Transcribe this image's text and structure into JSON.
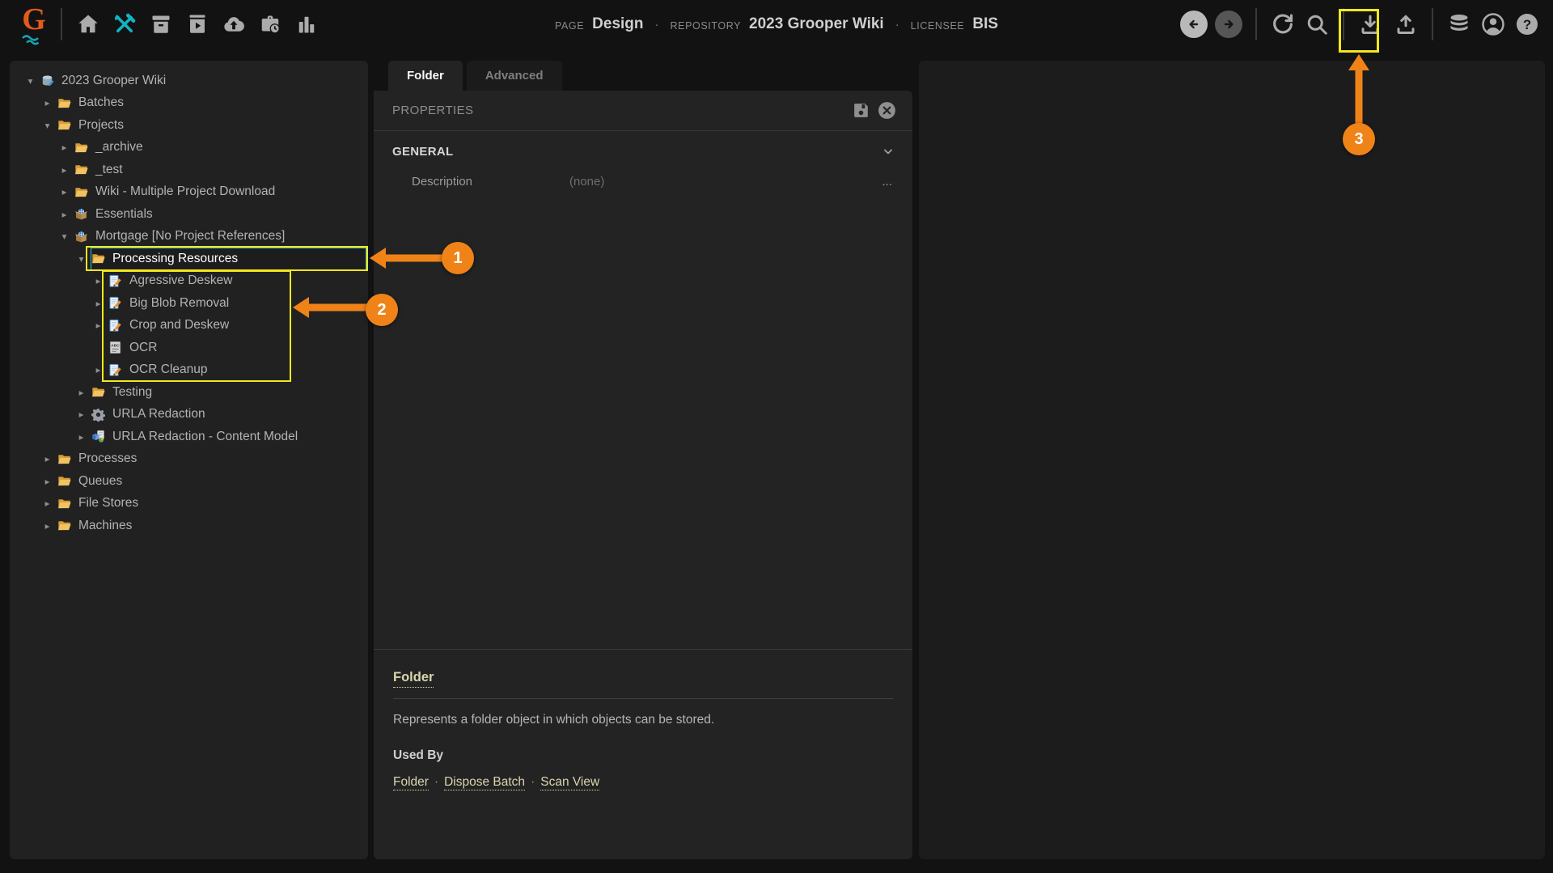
{
  "colors": {
    "accent_teal": "#12b3c4",
    "annotation_orange": "#ef8318",
    "annotation_yellow": "#f2e71d",
    "link_cream": "#d9d6ae"
  },
  "header": {
    "logo_text": "G",
    "page_label": "PAGE",
    "page_value": "Design",
    "repository_label": "REPOSITORY",
    "repository_value": "2023 Grooper Wiki",
    "licensee_label": "LICENSEE",
    "licensee_value": "BIS",
    "separator": "·",
    "left_icons": [
      {
        "name": "home",
        "active": false
      },
      {
        "name": "design-tools",
        "active": true
      },
      {
        "name": "archive-box",
        "active": false
      },
      {
        "name": "batch-play",
        "active": false
      },
      {
        "name": "cloud-upload",
        "active": false
      },
      {
        "name": "briefcase-clock",
        "active": false
      },
      {
        "name": "bar-chart",
        "active": false
      }
    ],
    "nav_buttons": [
      {
        "name": "back",
        "style": "back"
      },
      {
        "name": "forward",
        "style": "forward"
      }
    ],
    "action_icons_1": [
      {
        "name": "refresh"
      },
      {
        "name": "search"
      }
    ],
    "action_icons_2": [
      {
        "name": "download"
      },
      {
        "name": "upload"
      }
    ],
    "action_icons_3": [
      {
        "name": "database"
      },
      {
        "name": "user"
      },
      {
        "name": "help"
      }
    ]
  },
  "tree": {
    "items": [
      {
        "label": "2023 Grooper Wiki",
        "level": 0,
        "state": "expanded",
        "icon": "repository",
        "selected": false
      },
      {
        "label": "Batches",
        "level": 1,
        "state": "collapsed",
        "icon": "folder",
        "selected": false
      },
      {
        "label": "Projects",
        "level": 1,
        "state": "expanded",
        "icon": "folder",
        "selected": false
      },
      {
        "label": "_archive",
        "level": 2,
        "state": "collapsed",
        "icon": "folder",
        "selected": false
      },
      {
        "label": "_test",
        "level": 2,
        "state": "collapsed",
        "icon": "folder",
        "selected": false
      },
      {
        "label": "Wiki - Multiple Project Download",
        "level": 2,
        "state": "collapsed",
        "icon": "folder",
        "selected": false
      },
      {
        "label": "Essentials",
        "level": 2,
        "state": "collapsed",
        "icon": "project",
        "selected": false
      },
      {
        "label": "Mortgage [No Project References]",
        "level": 2,
        "state": "expanded",
        "icon": "project",
        "selected": false
      },
      {
        "label": "Processing Resources",
        "level": 3,
        "state": "expanded",
        "icon": "folder",
        "selected": true
      },
      {
        "label": "Agressive Deskew",
        "level": 4,
        "state": "collapsed",
        "icon": "ip-profile",
        "selected": false
      },
      {
        "label": "Big Blob Removal",
        "level": 4,
        "state": "collapsed",
        "icon": "ip-profile",
        "selected": false
      },
      {
        "label": "Crop and Deskew",
        "level": 4,
        "state": "collapsed",
        "icon": "ip-profile",
        "selected": false
      },
      {
        "label": "OCR",
        "level": 4,
        "state": "leaf",
        "icon": "ocr-profile",
        "selected": false
      },
      {
        "label": "OCR Cleanup",
        "level": 4,
        "state": "collapsed",
        "icon": "ip-profile",
        "selected": false
      },
      {
        "label": "Testing",
        "level": 3,
        "state": "collapsed",
        "icon": "folder",
        "selected": false
      },
      {
        "label": "URLA Redaction",
        "level": 3,
        "state": "collapsed",
        "icon": "gear",
        "selected": false
      },
      {
        "label": "URLA Redaction - Content Model",
        "level": 3,
        "state": "collapsed",
        "icon": "content-model",
        "selected": false
      },
      {
        "label": "Processes",
        "level": 1,
        "state": "collapsed",
        "icon": "folder",
        "selected": false
      },
      {
        "label": "Queues",
        "level": 1,
        "state": "collapsed",
        "icon": "folder",
        "selected": false
      },
      {
        "label": "File Stores",
        "level": 1,
        "state": "collapsed",
        "icon": "folder",
        "selected": false
      },
      {
        "label": "Machines",
        "level": 1,
        "state": "collapsed",
        "icon": "folder",
        "selected": false
      }
    ]
  },
  "tabs": [
    {
      "label": "Folder",
      "active": true
    },
    {
      "label": "Advanced",
      "active": false
    }
  ],
  "properties": {
    "header": "PROPERTIES",
    "general_section": "GENERAL",
    "description_label": "Description",
    "description_value": "(none)",
    "ellipsis_button": "..."
  },
  "help_panel": {
    "title": "Folder",
    "description": "Represents a folder object in which objects can be stored.",
    "used_by_label": "Used By",
    "used_by_links": [
      "Folder",
      "Dispose Batch",
      "Scan View"
    ],
    "link_separator": "·"
  },
  "annotations": {
    "callouts": [
      {
        "number": "1"
      },
      {
        "number": "2"
      },
      {
        "number": "3"
      }
    ]
  }
}
